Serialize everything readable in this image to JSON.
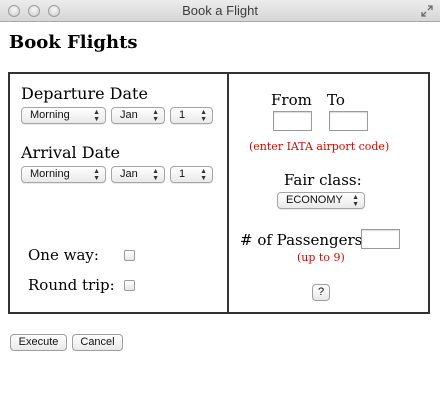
{
  "window": {
    "title": "Book a Flight"
  },
  "page": {
    "heading": "Book Flights"
  },
  "left": {
    "departure_label": "Departure Date",
    "departure": {
      "time": "Morning",
      "month": "Jan",
      "day": "1"
    },
    "arrival_label": "Arrival Date",
    "arrival": {
      "time": "Morning",
      "month": "Jan",
      "day": "1"
    },
    "oneway_label": "One way:",
    "roundtrip_label": "Round trip:"
  },
  "right": {
    "from_label": "From",
    "to_label": "To",
    "from_value": "",
    "to_value": "",
    "iata_hint": "(enter IATA airport code)",
    "fair_class_label": "Fair class:",
    "fair_class_value": "ECONOMY",
    "passengers_label": "# of Passengers:",
    "passengers_value": "",
    "passengers_hint": "(up to 9)",
    "help_button": "?"
  },
  "actions": {
    "execute": "Execute",
    "cancel": "Cancel"
  },
  "icons": {
    "window_controls": [
      "close-icon",
      "minimize-icon",
      "zoom-icon"
    ],
    "resize": "fullscreen-icon",
    "select_arrows": "updown-arrows-icon"
  }
}
